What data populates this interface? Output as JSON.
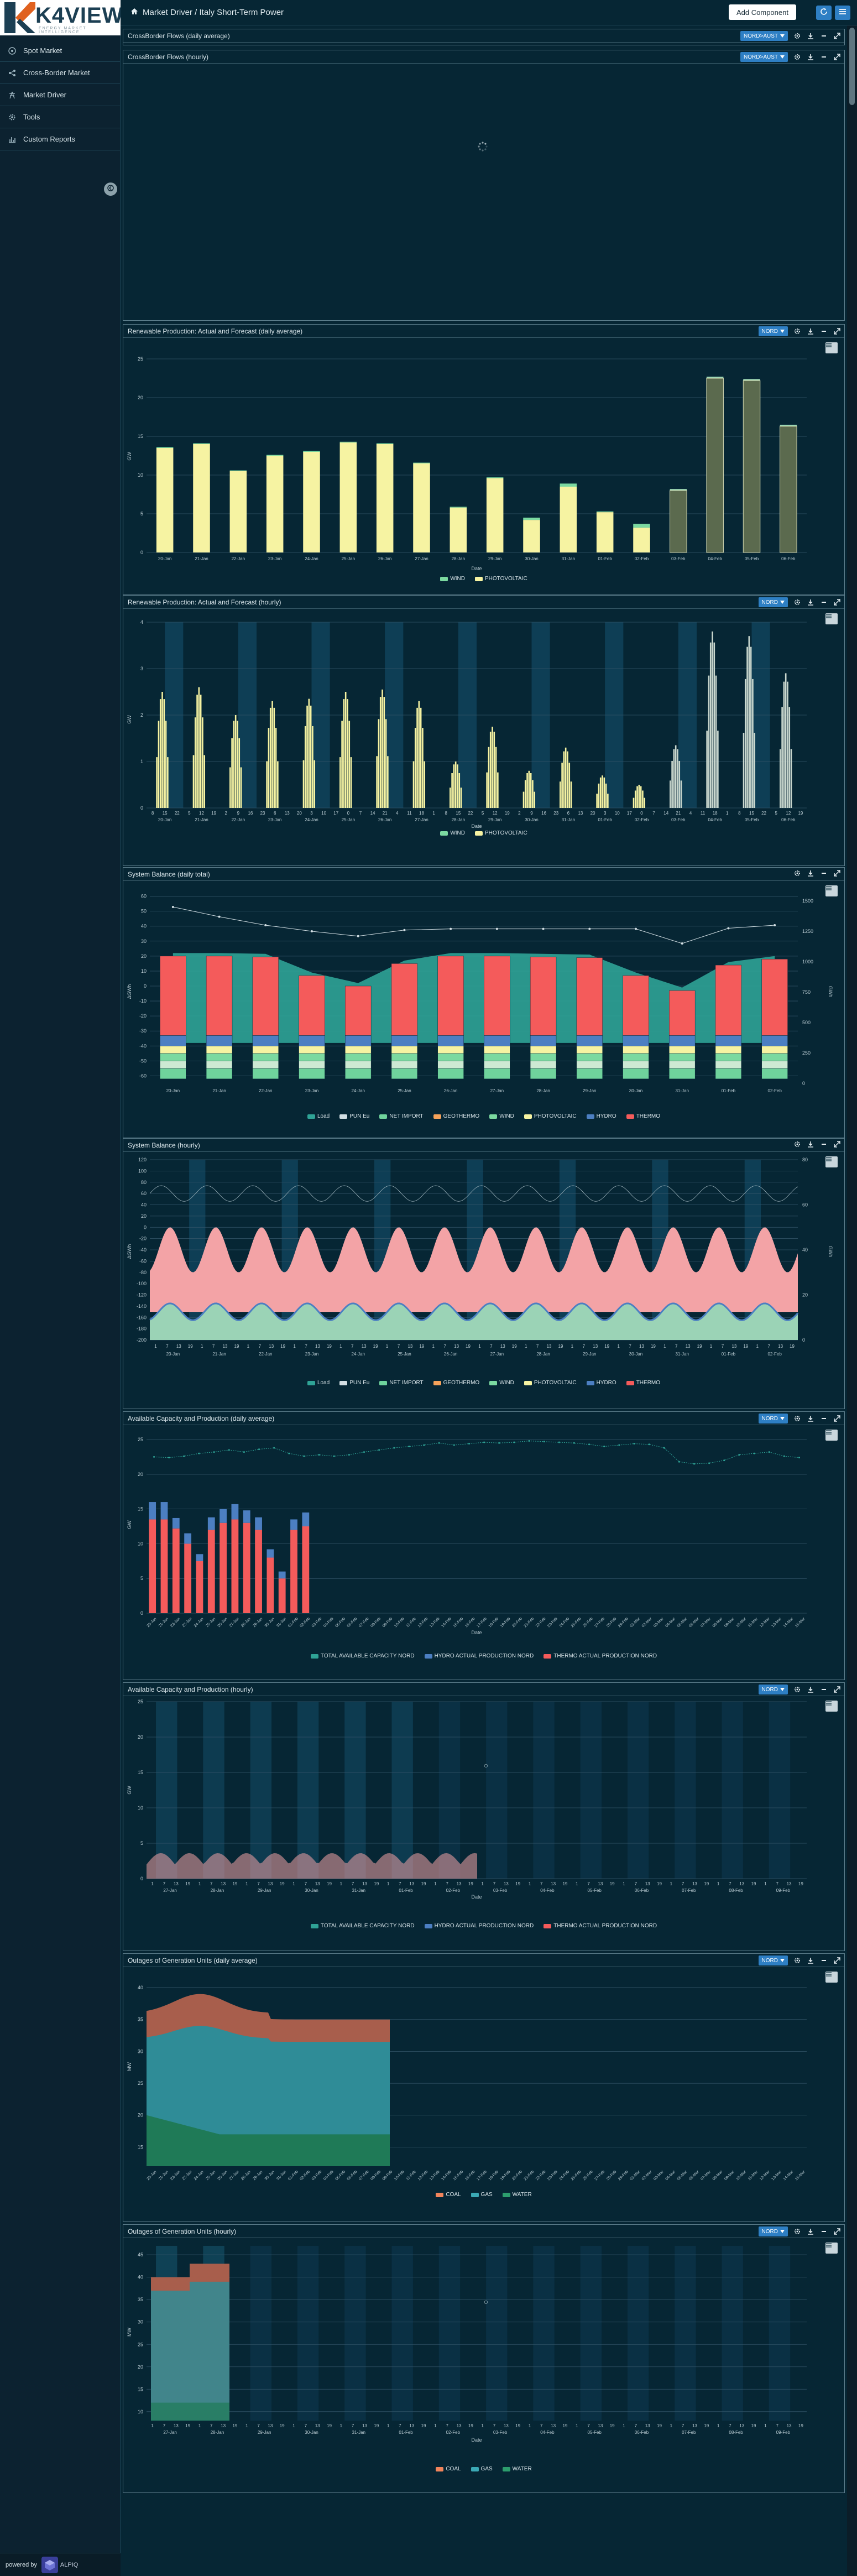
{
  "brand": {
    "name": "K4VIEW",
    "tagline": "ENERGY MARKET INTELLIGENCE",
    "colors": {
      "accent": "#2e7fc4",
      "bg": "#062634",
      "highlight": "#e0611f"
    }
  },
  "sidebar": {
    "items": [
      {
        "label": "Spot Market",
        "icon": "target-icon"
      },
      {
        "label": "Cross-Border Market",
        "icon": "flow-icon"
      },
      {
        "label": "Market Driver",
        "icon": "tower-icon"
      },
      {
        "label": "Tools",
        "icon": "gear-icon"
      },
      {
        "label": "Custom Reports",
        "icon": "chart-icon"
      }
    ],
    "powered_label": "powered by",
    "powered_brand": "ALPIQ"
  },
  "topbar": {
    "breadcrumb": "Market Driver / Italy Short-Term Power",
    "add_label": "Add Component"
  },
  "panels": [
    {
      "title": "CrossBorder Flows (daily average)",
      "selector": "NORD>AUST"
    },
    {
      "title": "CrossBorder Flows (hourly)",
      "selector": "NORD>AUST"
    },
    {
      "title": "Renewable Production: Actual and Forecast (daily average)",
      "selector": "NORD"
    },
    {
      "title": "Renewable Production: Actual and Forecast (hourly)",
      "selector": "NORD"
    },
    {
      "title": "System Balance (daily total)",
      "selector": ""
    },
    {
      "title": "System Balance (hourly)",
      "selector": ""
    },
    {
      "title": "Available Capacity and Production (daily average)",
      "selector": "NORD"
    },
    {
      "title": "Available Capacity and Production (hourly)",
      "selector": "NORD"
    },
    {
      "title": "Outages of Generation Units (daily average)",
      "selector": "NORD"
    },
    {
      "title": "Outages of Generation Units (hourly)",
      "selector": "NORD"
    }
  ],
  "chart_data": [
    {
      "type": "bar",
      "panel": 2,
      "ylabel": "GW",
      "xlabel": "Date",
      "ylim": [
        0,
        25
      ],
      "yticks": [
        0,
        5,
        10,
        15,
        20,
        25
      ],
      "categories": [
        "20-Jan",
        "21-Jan",
        "22-Jan",
        "23-Jan",
        "24-Jan",
        "25-Jan",
        "26-Jan",
        "27-Jan",
        "28-Jan",
        "29-Jan",
        "30-Jan",
        "31-Jan",
        "01-Feb",
        "02-Feb",
        "03-Feb",
        "04-Feb",
        "05-Feb",
        "06-Feb"
      ],
      "series": [
        {
          "name": "WIND",
          "color": "#7bd9a0",
          "values": [
            0.1,
            0.1,
            0.1,
            0.1,
            0.1,
            0.1,
            0.1,
            0.1,
            0.1,
            0.1,
            0.3,
            0.4,
            0.1,
            0.5,
            0.2,
            0.2,
            0.2,
            0.2
          ]
        },
        {
          "name": "PHOTOVOLTAIC",
          "color": "#f6f3a2",
          "values": [
            13.5,
            14,
            10.5,
            12.5,
            13,
            14.2,
            14,
            11.5,
            5.8,
            9.6,
            4.2,
            8.5,
            5.2,
            3.2,
            8.0,
            22.5,
            22.2,
            16.3
          ]
        }
      ],
      "forecast_from": "03-Feb",
      "legend": "bottom-center"
    },
    {
      "type": "bar",
      "panel": 3,
      "ylabel": "GW",
      "xlabel": "Date",
      "ylim": [
        0,
        4
      ],
      "yticks": [
        0,
        1,
        2,
        3,
        4
      ],
      "categories": [
        "20-Jan",
        "21-Jan",
        "22-Jan",
        "23-Jan",
        "24-Jan",
        "25-Jan",
        "26-Jan",
        "27-Jan",
        "28-Jan",
        "29-Jan",
        "30-Jan",
        "31-Jan",
        "01-Feb",
        "02-Feb",
        "03-Feb",
        "04-Feb",
        "05-Feb",
        "06-Feb"
      ],
      "hour_ticks": [
        "8",
        "15",
        "22",
        "5",
        "12",
        "19",
        "2",
        "9",
        "16",
        "23",
        "6",
        "13",
        "20",
        "3",
        "10",
        "17",
        "0",
        "7",
        "14",
        "21",
        "4",
        "11",
        "18",
        "1",
        "8",
        "15",
        "22",
        "5",
        "12",
        "19",
        "2",
        "9",
        "16",
        "23",
        "6",
        "13",
        "20",
        "3",
        "10",
        "17",
        "0",
        "7",
        "14",
        "21",
        "4",
        "11",
        "18",
        "1",
        "8",
        "15",
        "22",
        "5",
        "12",
        "19"
      ],
      "daily_peak": [
        2.5,
        2.6,
        2.0,
        2.3,
        2.35,
        2.5,
        2.55,
        2.3,
        1.0,
        1.75,
        0.8,
        1.3,
        0.7,
        0.5,
        1.35,
        3.8,
        3.7,
        2.9
      ],
      "series": [
        {
          "name": "WIND",
          "color": "#7bd9a0"
        },
        {
          "name": "PHOTOVOLTAIC",
          "color": "#f6f3a2"
        }
      ],
      "legend": "bottom-center"
    },
    {
      "type": "bar",
      "panel": 4,
      "ylabel": "ΔGWh",
      "ylabel_right": "GWh",
      "ylim": [
        -65,
        65
      ],
      "yticks": [
        -60,
        -50,
        -40,
        -30,
        -20,
        -10,
        0,
        10,
        20,
        30,
        40,
        50,
        60
      ],
      "y2ticks": [
        0,
        250,
        500,
        750,
        1000,
        1250,
        1500
      ],
      "categories": [
        "20-Jan",
        "21-Jan",
        "22-Jan",
        "23-Jan",
        "24-Jan",
        "25-Jan",
        "26-Jan",
        "27-Jan",
        "28-Jan",
        "29-Jan",
        "30-Jan",
        "31-Jan",
        "01-Feb",
        "02-Feb"
      ],
      "load": [
        1450,
        1370,
        1300,
        1250,
        1210,
        1260,
        1270,
        1270,
        1270,
        1270,
        1270,
        1150,
        1275,
        1300
      ],
      "series": [
        {
          "name": "Load",
          "color": "#2fa396"
        },
        {
          "name": "PUN Eu",
          "color": "#d2dee3"
        },
        {
          "name": "NET IMPORT",
          "color": "#6fd39c"
        },
        {
          "name": "GEOTHERMO",
          "color": "#f5a25a"
        },
        {
          "name": "WIND",
          "color": "#7bd9a0"
        },
        {
          "name": "PHOTOVOLTAIC",
          "color": "#f6f3a2"
        },
        {
          "name": "HYDRO",
          "color": "#4c7fc2"
        },
        {
          "name": "THERMO",
          "color": "#f45b5b"
        }
      ],
      "thermo_top": [
        20,
        20,
        19.5,
        7,
        0,
        15,
        20,
        20,
        19.5,
        19,
        7,
        -3,
        14,
        18
      ],
      "legend": "bottom-center"
    },
    {
      "type": "area",
      "panel": 5,
      "ylabel": "ΔGWh",
      "ylabel_right": "GWh",
      "yticks": [
        120,
        100,
        80,
        60,
        40,
        20,
        0,
        -20,
        -40,
        -60,
        -80,
        -100,
        -120,
        -140,
        -160,
        -180,
        -200
      ],
      "y2ticks": [
        0,
        20,
        40,
        60,
        80
      ],
      "categories": [
        "20-Jan",
        "21-Jan",
        "22-Jan",
        "23-Jan",
        "24-Jan",
        "25-Jan",
        "26-Jan",
        "27-Jan",
        "28-Jan",
        "29-Jan",
        "30-Jan",
        "31-Jan",
        "01-Feb",
        "02-Feb"
      ],
      "hour_ticks": [
        "1",
        "7",
        "13",
        "19"
      ],
      "legend": "bottom-center"
    },
    {
      "type": "bar",
      "panel": 6,
      "ylabel": "GW",
      "xlabel": "Date",
      "ylim": [
        0,
        25
      ],
      "yticks": [
        0,
        5,
        10,
        15,
        20,
        25
      ],
      "categories": [
        "20-Jan",
        "21-Jan",
        "22-Jan",
        "23-Jan",
        "24-Jan",
        "25-Jan",
        "26-Jan",
        "27-Jan",
        "28-Jan",
        "29-Jan",
        "30-Jan",
        "31-Jan",
        "01-Feb",
        "02-Feb",
        "03-Feb",
        "04-Feb",
        "05-Feb",
        "06-Feb",
        "07-Feb",
        "08-Feb",
        "09-Feb",
        "10-Feb",
        "11-Feb",
        "12-Feb",
        "13-Feb",
        "14-Feb",
        "15-Feb",
        "16-Feb",
        "17-Feb",
        "18-Feb",
        "19-Feb",
        "20-Feb",
        "21-Feb",
        "22-Feb",
        "23-Feb",
        "24-Feb",
        "25-Feb",
        "26-Feb",
        "27-Feb",
        "28-Feb",
        "29-Feb",
        "01-Mar",
        "02-Mar",
        "03-Mar",
        "04-Mar",
        "05-Mar",
        "06-Mar",
        "07-Mar",
        "08-Mar",
        "09-Mar",
        "10-Mar",
        "11-Mar",
        "12-Mar",
        "13-Mar",
        "14-Mar",
        "15-Mar"
      ],
      "series": [
        {
          "name": "TOTAL AVAILABLE CAPACITY NORD",
          "color": "#2fa396"
        },
        {
          "name": "HYDRO ACTUAL PRODUCTION NORD",
          "color": "#4c7fc2"
        },
        {
          "name": "THERMO ACTUAL PRODUCTION NORD",
          "color": "#f45b5b"
        }
      ],
      "thermo": [
        13.5,
        13.5,
        12.2,
        10,
        7.5,
        12,
        13,
        13.5,
        13,
        12,
        8,
        5,
        12,
        12.5
      ],
      "hydro": [
        2.5,
        2.5,
        1.5,
        1.5,
        1,
        1.8,
        2,
        2.2,
        1.8,
        1.8,
        1.2,
        1,
        1.5,
        2
      ],
      "capacity": [
        22.5,
        22.4,
        22.6,
        23,
        23.2,
        23.5,
        23.2,
        23.6,
        23.8,
        23,
        22.6,
        22.8,
        22.6,
        22.8,
        23.2,
        23.5,
        23.8,
        24,
        24.2,
        24.5,
        24.2,
        24.4,
        24.6,
        24.5,
        24.6,
        24.8,
        24.7,
        24.6,
        24.5,
        24.3,
        24,
        24.2,
        24.4,
        24.3,
        23.8,
        21.8,
        21.5,
        21.6,
        22,
        22.8,
        23,
        23.2,
        22.6,
        22.4
      ],
      "legend": "bottom-center"
    },
    {
      "type": "bar",
      "panel": 7,
      "ylabel": "GW",
      "xlabel": "Date",
      "ylim": [
        0,
        25
      ],
      "yticks": [
        0,
        5,
        10,
        15,
        20,
        25
      ],
      "categories": [
        "27-Jan",
        "28-Jan",
        "29-Jan",
        "30-Jan",
        "31-Jan",
        "01-Feb",
        "02-Feb",
        "03-Feb",
        "04-Feb",
        "05-Feb",
        "06-Feb",
        "07-Feb",
        "08-Feb",
        "09-Feb"
      ],
      "series": [
        {
          "name": "TOTAL AVAILABLE CAPACITY NORD",
          "color": "#2fa396"
        },
        {
          "name": "HYDRO ACTUAL PRODUCTION NORD",
          "color": "#4c7fc2"
        },
        {
          "name": "THERMO ACTUAL PRODUCTION NORD",
          "color": "#f45b5b"
        }
      ],
      "legend": "bottom-center"
    },
    {
      "type": "area",
      "panel": 8,
      "ylabel": "MW",
      "yticks": [
        40,
        35,
        30,
        25,
        20,
        15
      ],
      "series": [
        {
          "name": "COAL",
          "color": "#f1845b"
        },
        {
          "name": "GAS",
          "color": "#3ba9b5"
        },
        {
          "name": "WATER",
          "color": "#2c9d6d"
        }
      ],
      "legend": "bottom-center"
    },
    {
      "type": "area",
      "panel": 9,
      "ylabel": "MW",
      "xlabel": "Date",
      "yticks": [
        45,
        40,
        35,
        30,
        25,
        20,
        15,
        10
      ],
      "categories": [
        "27-Jan",
        "28-Jan",
        "29-Jan",
        "30-Jan",
        "31-Jan",
        "01-Feb",
        "02-Feb",
        "03-Feb",
        "04-Feb",
        "05-Feb",
        "06-Feb",
        "07-Feb",
        "08-Feb",
        "09-Feb"
      ],
      "series": [
        {
          "name": "COAL",
          "color": "#f1845b"
        },
        {
          "name": "GAS",
          "color": "#3ba9b5"
        },
        {
          "name": "WATER",
          "color": "#2c9d6d"
        }
      ],
      "legend": "bottom-center"
    }
  ]
}
